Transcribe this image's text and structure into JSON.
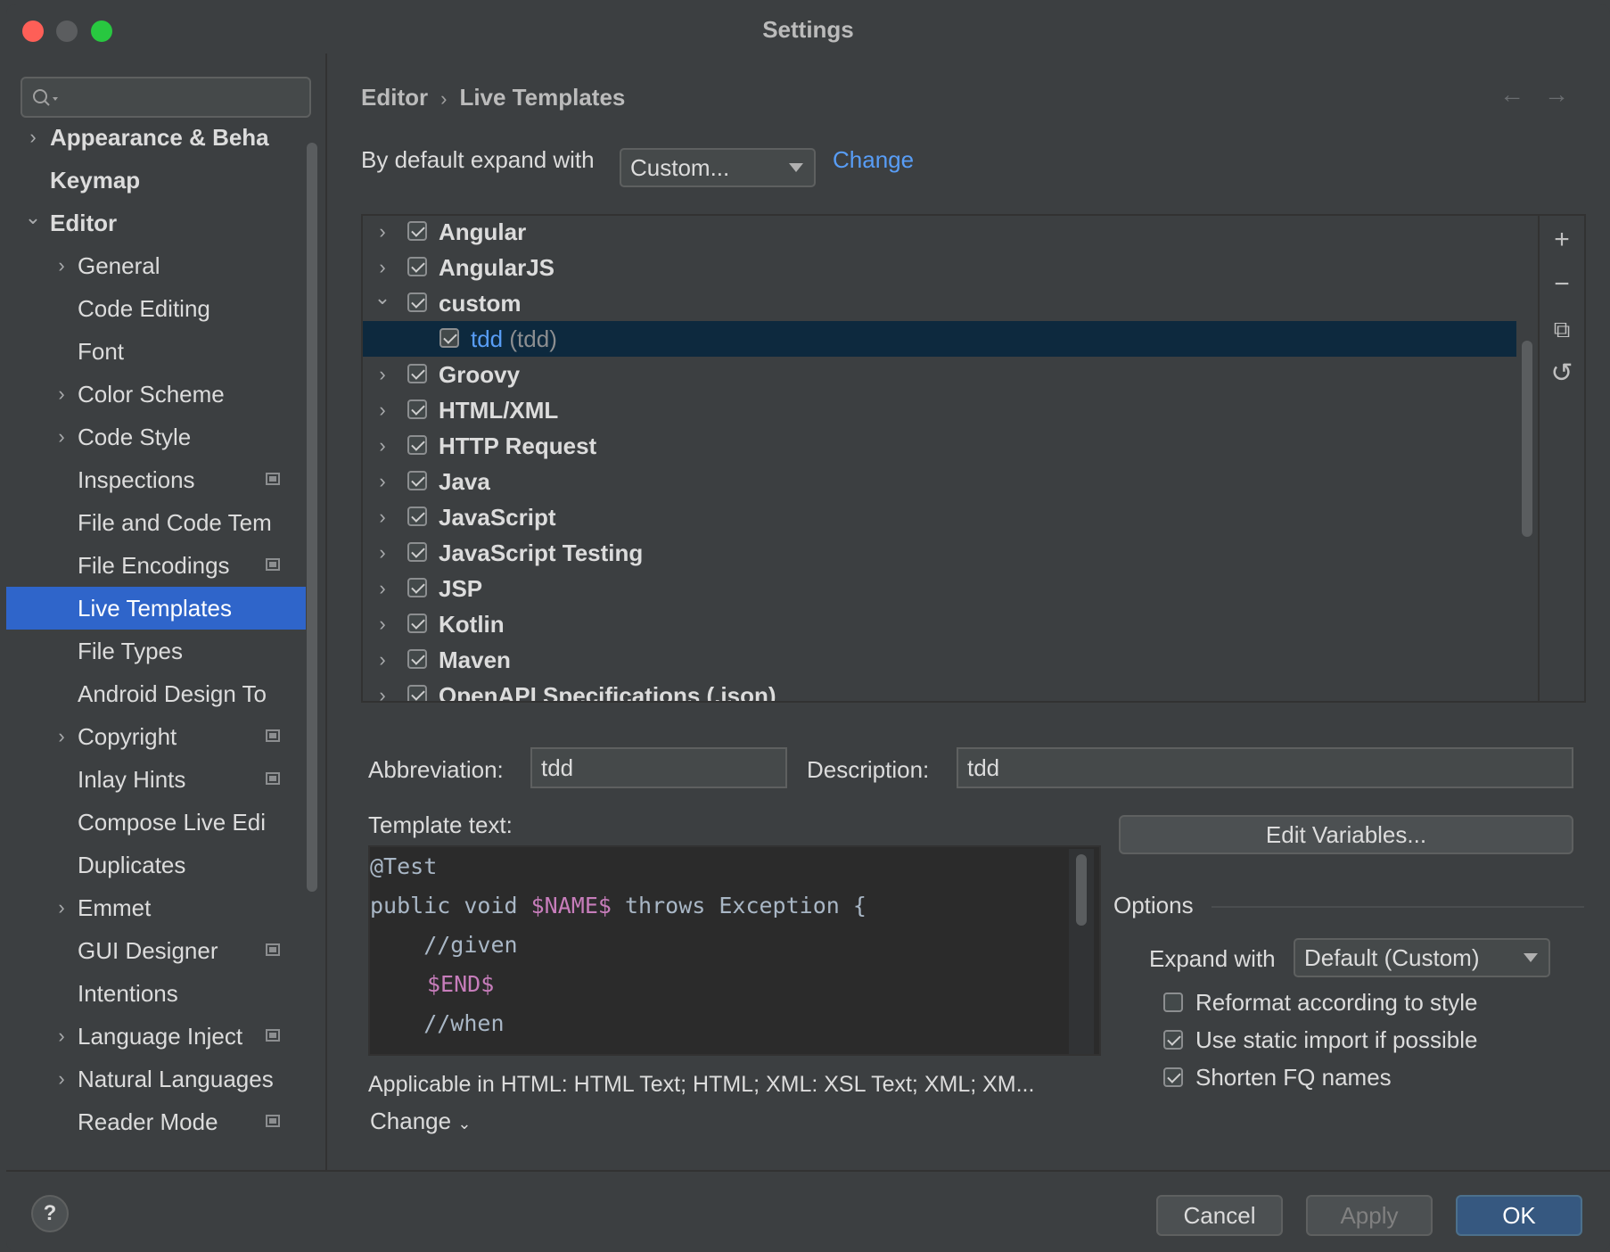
{
  "window": {
    "title": "Settings"
  },
  "search": {
    "placeholder": ""
  },
  "sidebar": {
    "items": [
      {
        "label": "Appearance & Beha",
        "chevron": "›"
      },
      {
        "label": "Keymap",
        "chevron": ""
      },
      {
        "label": "Editor",
        "chevron": "⌄"
      },
      {
        "label": "General",
        "chevron": "›"
      },
      {
        "label": "Code Editing",
        "chevron": ""
      },
      {
        "label": "Font",
        "chevron": ""
      },
      {
        "label": "Color Scheme",
        "chevron": "›"
      },
      {
        "label": "Code Style",
        "chevron": "›"
      },
      {
        "label": "Inspections",
        "chevron": ""
      },
      {
        "label": "File and Code Tem",
        "chevron": ""
      },
      {
        "label": "File Encodings",
        "chevron": ""
      },
      {
        "label": "Live Templates",
        "chevron": ""
      },
      {
        "label": "File Types",
        "chevron": ""
      },
      {
        "label": "Android Design To",
        "chevron": ""
      },
      {
        "label": "Copyright",
        "chevron": "›"
      },
      {
        "label": "Inlay Hints",
        "chevron": ""
      },
      {
        "label": "Compose Live Edi",
        "chevron": ""
      },
      {
        "label": "Duplicates",
        "chevron": ""
      },
      {
        "label": "Emmet",
        "chevron": "›"
      },
      {
        "label": "GUI Designer",
        "chevron": ""
      },
      {
        "label": "Intentions",
        "chevron": ""
      },
      {
        "label": "Language Inject",
        "chevron": "›"
      },
      {
        "label": "Natural Languages",
        "chevron": "›"
      },
      {
        "label": "Reader Mode",
        "chevron": ""
      }
    ]
  },
  "breadcrumb": {
    "parent": "Editor",
    "separator": "›",
    "current": "Live Templates"
  },
  "nav": {
    "back": "←",
    "forward": "→"
  },
  "expand": {
    "label": "By default expand with",
    "value": "Custom...",
    "change": "Change"
  },
  "templates": [
    {
      "chevron": "›",
      "name": "Angular",
      "sub": ""
    },
    {
      "chevron": "›",
      "name": "AngularJS",
      "sub": ""
    },
    {
      "chevron": "⌄",
      "name": "custom",
      "sub": ""
    },
    {
      "chevron": "",
      "name": "tdd",
      "sub": "(tdd)"
    },
    {
      "chevron": "›",
      "name": "Groovy",
      "sub": ""
    },
    {
      "chevron": "›",
      "name": "HTML/XML",
      "sub": ""
    },
    {
      "chevron": "›",
      "name": "HTTP Request",
      "sub": ""
    },
    {
      "chevron": "›",
      "name": "Java",
      "sub": ""
    },
    {
      "chevron": "›",
      "name": "JavaScript",
      "sub": ""
    },
    {
      "chevron": "›",
      "name": "JavaScript Testing",
      "sub": ""
    },
    {
      "chevron": "›",
      "name": "JSP",
      "sub": ""
    },
    {
      "chevron": "›",
      "name": "Kotlin",
      "sub": ""
    },
    {
      "chevron": "›",
      "name": "Maven",
      "sub": ""
    },
    {
      "chevron": "›",
      "name": "OpenAPI Specifications (.json)",
      "sub": ""
    }
  ],
  "tools": {
    "add": "+",
    "remove": "−",
    "copy": "⧉",
    "restore": "↺"
  },
  "detail": {
    "abbreviation_label": "Abbreviation:",
    "abbreviation": "tdd",
    "description_label": "Description:",
    "description": "tdd",
    "template_label": "Template text:",
    "edit_variables": "Edit Variables...",
    "code": {
      "l1": "@Test",
      "l2a": "public void ",
      "l2b": "$NAME$",
      "l2c": " throws Exception {",
      "l3": "    //given",
      "l4": "$END$",
      "l5": "    //when"
    },
    "applicable": "Applicable in HTML: HTML Text; HTML; XML: XSL Text; XML; XM...",
    "change": "Change"
  },
  "options": {
    "title": "Options",
    "expand_label": "Expand with",
    "expand_value": "Default (Custom)",
    "reformat": "Reformat according to style",
    "static_import": "Use static import if possible",
    "shorten": "Shorten FQ names"
  },
  "footer": {
    "help": "?",
    "cancel": "Cancel",
    "apply": "Apply",
    "ok": "OK"
  }
}
